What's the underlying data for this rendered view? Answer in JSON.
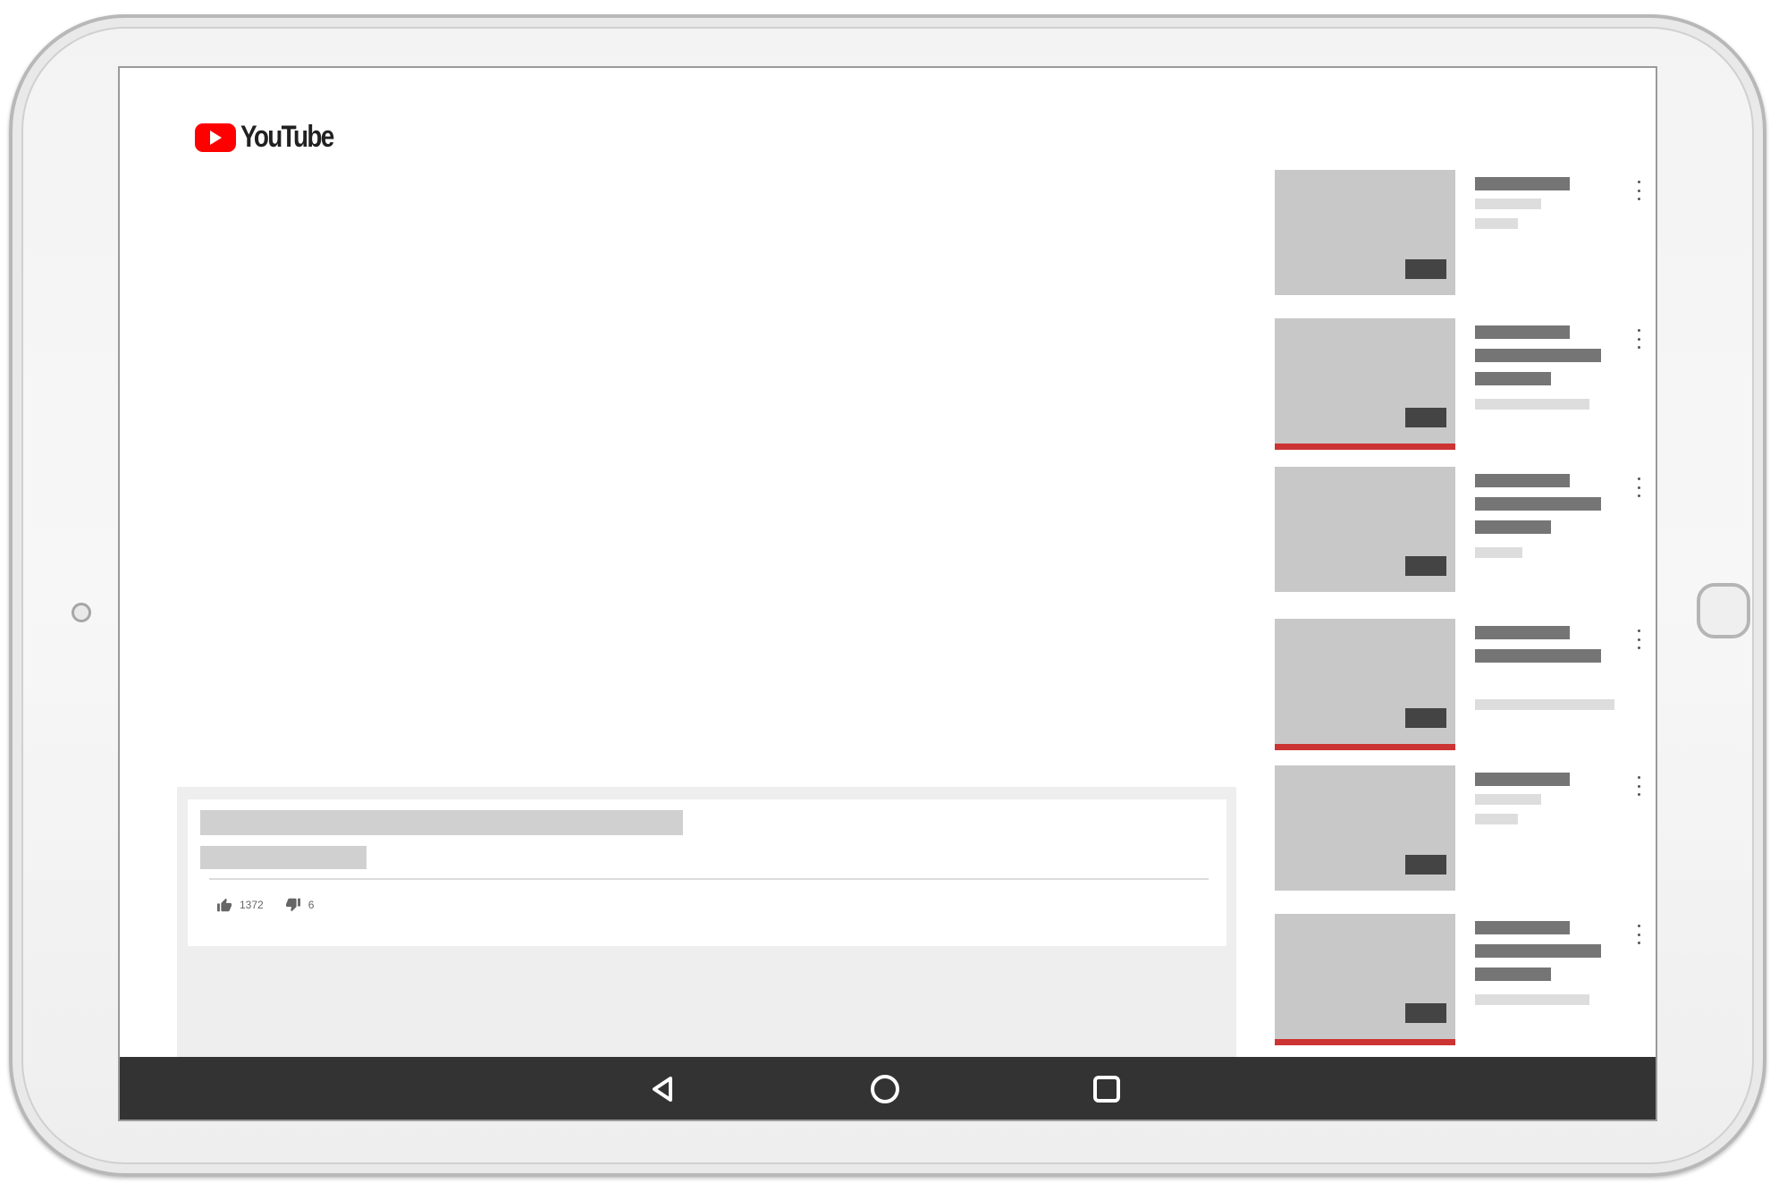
{
  "app": {
    "logo_text": "YouTube",
    "brand_color": "#ff0000"
  },
  "video": {
    "likes": "1372",
    "dislikes": "6"
  },
  "icons": {
    "like": "thumbs-up-icon",
    "dislike": "thumbs-down-icon",
    "more": "more-vert-icon",
    "back": "back-triangle-icon",
    "home": "home-circle-icon",
    "recents": "recents-square-icon"
  },
  "recommendations": [
    {
      "watched": false
    },
    {
      "watched": true
    },
    {
      "watched": false
    },
    {
      "watched": true
    },
    {
      "watched": false
    },
    {
      "watched": true
    }
  ],
  "colors": {
    "progress": "#cc3333",
    "navbar": "#333333"
  }
}
